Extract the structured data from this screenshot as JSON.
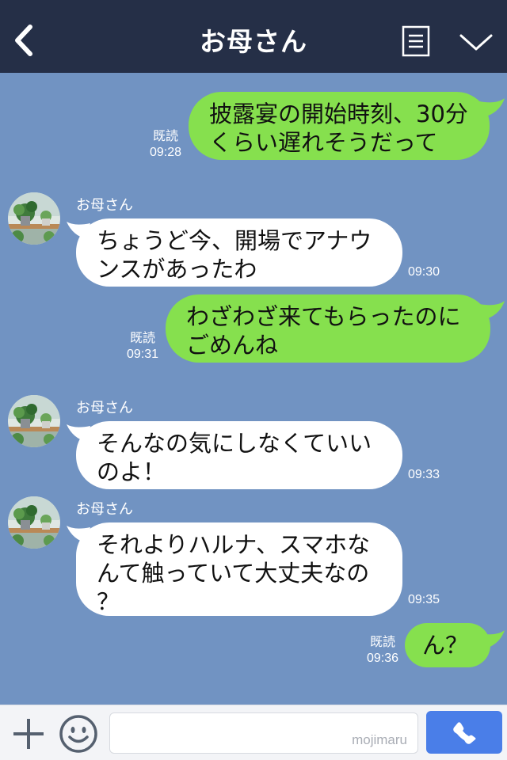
{
  "header": {
    "title": "お母さん"
  },
  "messages": [
    {
      "side": "out",
      "lines": [
        "披露宴の開始時刻、30分",
        "くらい遅れそうだって"
      ],
      "read": "既読",
      "time": "09:28"
    },
    {
      "side": "in",
      "sender": "お母さん",
      "lines": [
        "ちょうど今、開場でアナウ",
        "ンスがあったわ"
      ],
      "time": "09:30"
    },
    {
      "side": "out",
      "lines": [
        "わざわざ来てもらったのに",
        "ごめんね"
      ],
      "read": "既読",
      "time": "09:31"
    },
    {
      "side": "in",
      "sender": "お母さん",
      "lines": [
        "そんなの気にしなくていい",
        "のよ！"
      ],
      "time": "09:33"
    },
    {
      "side": "in",
      "sender": "お母さん",
      "lines": [
        "それよりハルナ、スマホな",
        "んて触っていて大丈夫なの",
        "？"
      ],
      "time": "09:35"
    },
    {
      "side": "out",
      "lines": [
        "ん？"
      ],
      "read": "既読",
      "time": "09:36"
    }
  ],
  "input_bar": {
    "placeholder": "",
    "watermark": "mojimaru"
  },
  "colors": {
    "header_bg": "#252f47",
    "chat_bg": "#7193c2",
    "outgoing_bubble": "#86e04e",
    "incoming_bubble": "#ffffff",
    "call_button": "#4a7ee8"
  },
  "icons": [
    "back-arrow-icon",
    "menu-list-icon",
    "chevron-down-icon",
    "plus-icon",
    "emoji-icon",
    "phone-icon"
  ]
}
